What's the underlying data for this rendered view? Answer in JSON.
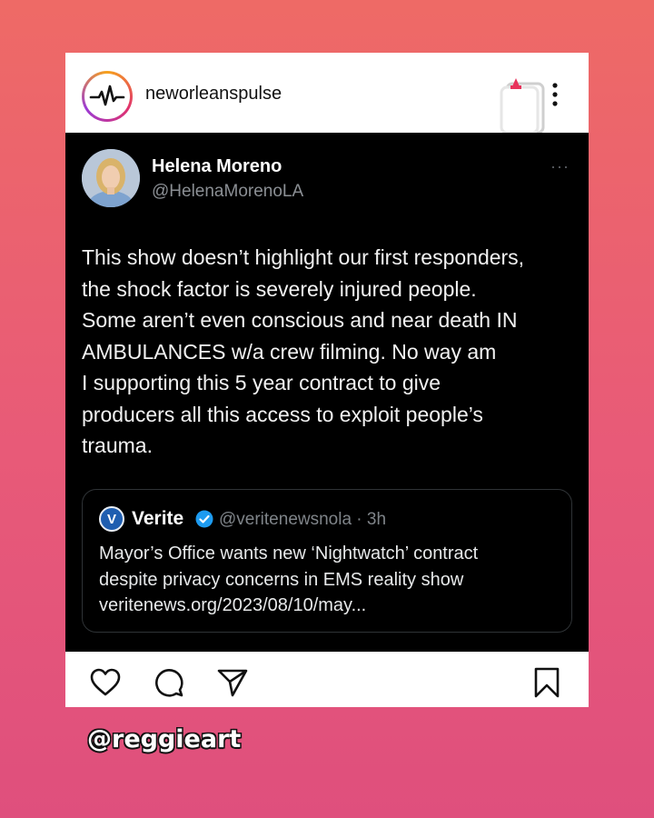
{
  "account": {
    "username": "neworleanspulse",
    "avatar_icon": "heartbeat-pulse-icon",
    "pin_icon": "pin-icon",
    "more_icon": "vertical-dots-icon"
  },
  "tweet": {
    "name": "Helena Moreno",
    "handle": "@HelenaMorenoLA",
    "more": "···",
    "text": "This show doesn’t highlight our first responders,\nthe shock factor is severely injured people.\nSome aren’t even conscious and near death IN\nAMBULANCES w/a crew filming.  No way am\nI supporting this 5 year contract to give\nproducers all this access to exploit people’s\ntrauma.",
    "quote": {
      "logo_letter": "V",
      "name": "Verite",
      "handle_time": "@veritenewsnola · 3h",
      "body": "Mayor’s Office wants new ‘Nightwatch’ contract\ndespite privacy concerns in EMS reality show\nveritenews.org/2023/08/10/may..."
    }
  },
  "actions": [
    "heart-icon",
    "comment-icon",
    "share-icon",
    "bookmark-icon"
  ],
  "watermark": "@reggieart",
  "colors": {
    "background_top": "#ee6a66",
    "background_bottom": "#df4f7d",
    "tweet_bg": "#000000",
    "verified_blue": "#1d9bf0"
  }
}
